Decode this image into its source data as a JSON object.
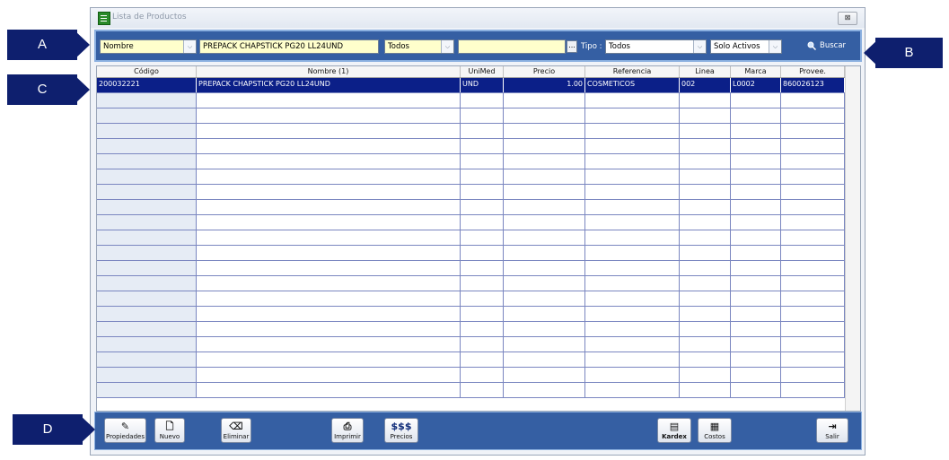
{
  "window": {
    "title": "Lista de Productos",
    "close_glyph": "⊠"
  },
  "toolbar": {
    "field_selector": "Nombre",
    "search_text": "PREPACK CHAPSTICK PG20 LL24UND",
    "scope": "Todos",
    "filter_value": "",
    "browse_label": "...",
    "tipo_label": "Tipo :",
    "tipo_value": "Todos",
    "status_value": "Solo Activos",
    "search_button": "Buscar"
  },
  "grid": {
    "columns": [
      "Código",
      "Nombre (1)",
      "UniMed",
      "Precio",
      "Referencia",
      "Linea",
      "Marca",
      "Provee."
    ],
    "rows": [
      [
        "200032221",
        "PREPACK CHAPSTICK PG20 LL24UND",
        "UND",
        "1.00",
        "COSMETICOS",
        "002",
        "L0002",
        "860026123"
      ]
    ]
  },
  "footer": {
    "propiedades": "Propiedades",
    "nuevo": "Nuevo",
    "eliminar": "Eliminar",
    "imprimir": "Imprimir",
    "precios_icon_text": "$$$",
    "precios": "Precios",
    "kardex": "Kardex",
    "costos": "Costos",
    "salir": "Salir"
  },
  "callouts": {
    "a": "A",
    "b": "B",
    "c": "C",
    "d": "D"
  },
  "colors": {
    "toolbar": "#355fa3",
    "selected_row": "#0b1f88",
    "field": "#ffffcc",
    "callout": "#0e1f6e"
  }
}
